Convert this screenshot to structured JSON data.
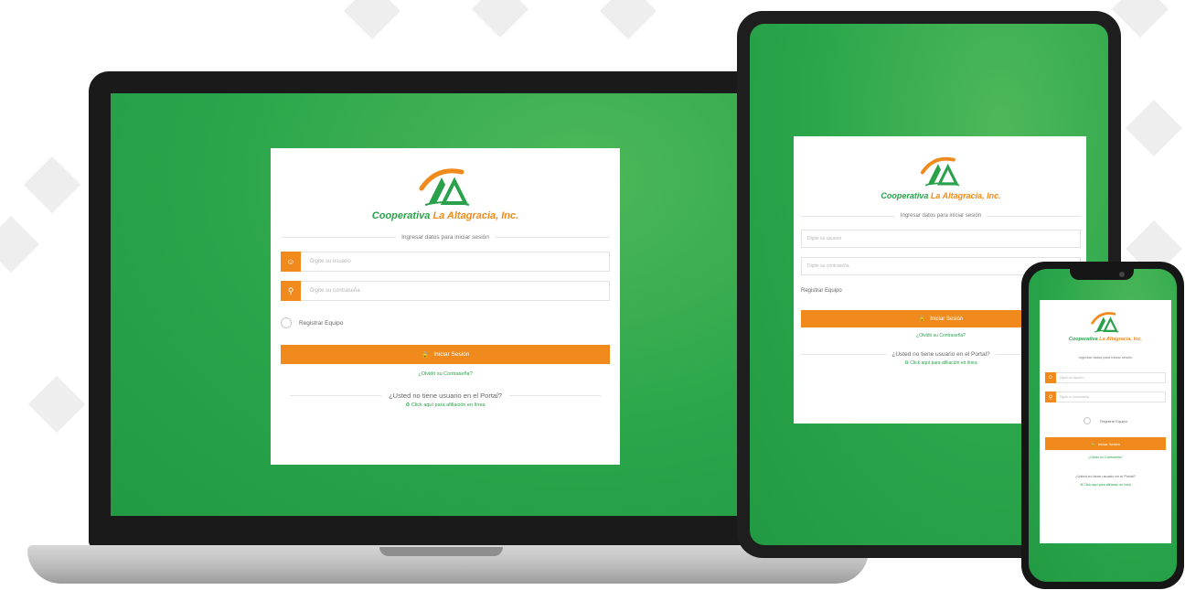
{
  "brand": {
    "name_prefix": "Cooperativa ",
    "name_highlight": "La Altagracia, Inc.",
    "logo_icon": "cooperativa-logo-icon",
    "primary_color": "#2aa14b",
    "accent_color": "#f08a1c"
  },
  "login": {
    "subtitle": "Ingresar datos para iniciar sesión",
    "username_placeholder": "Digite su usuario",
    "password_placeholder": "Digite su contraseña",
    "remember_label": "Registrar Equipo",
    "submit_label": "Iniciar Sesión",
    "forgot_password": "¿Olvidó su Contraseña?",
    "no_user_prompt": "¿Usted no tiene usuario en el Portal?",
    "affiliate_link": "Click aquí para afiliación en línea",
    "user_icon": "user-icon",
    "key_icon": "key-icon",
    "lock_icon": "lock-icon",
    "affiliate_icon": "link-icon"
  }
}
